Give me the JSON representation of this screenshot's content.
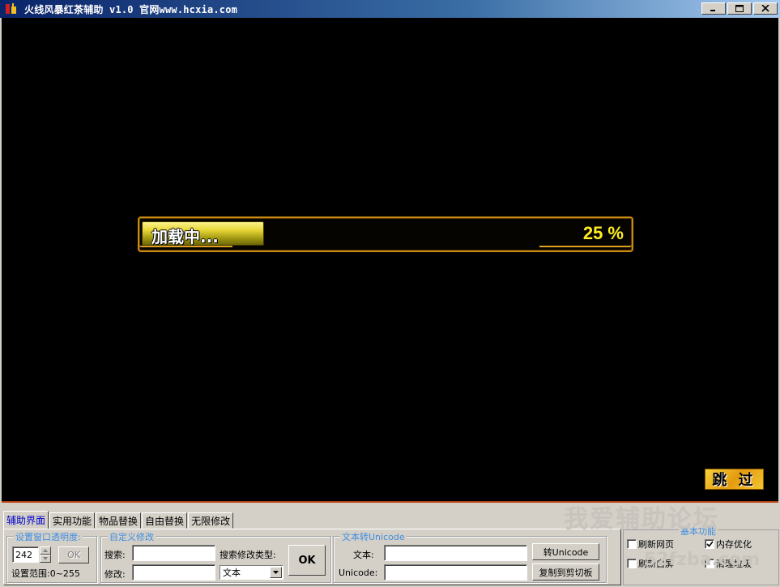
{
  "window": {
    "title": "火线风暴红茶辅助 v1.0 官网www.hcxia.com"
  },
  "game": {
    "loading_label": "加载中...",
    "loading_percent_text": "25 %",
    "loading_progress": 0.25,
    "skip_label": "跳 过"
  },
  "tabs": [
    {
      "label": "辅助界面",
      "active": true
    },
    {
      "label": "实用功能"
    },
    {
      "label": "物品替换"
    },
    {
      "label": "自由替换"
    },
    {
      "label": "无限修改"
    }
  ],
  "opacity": {
    "title": "设置窗口透明度:",
    "value": "242",
    "ok_label": "OK",
    "range_label": "设置范围:0~255"
  },
  "custom": {
    "title": "自定义修改",
    "search_label": "搜索:",
    "modify_label": "修改:",
    "search_value": "",
    "modify_value": "",
    "type_label": "搜索修改类型:",
    "type_selected": "文本",
    "ok_label": "OK"
  },
  "unicode": {
    "title": "文本转Unicode",
    "text_label": "文本:",
    "unicode_label": "Unicode:",
    "text_value": "",
    "unicode_value": "",
    "convert_label": "转Unicode",
    "copy_label": "复制到剪切板"
  },
  "basic": {
    "title": "基本功能",
    "items": [
      {
        "label": "刷新网页",
        "checked": false
      },
      {
        "label": "内存优化",
        "checked": true
      },
      {
        "label": "刷新白屏",
        "checked": false
      },
      {
        "label": "清理垃圾",
        "checked": false
      }
    ]
  },
  "watermark": {
    "big": "我爱辅助论坛",
    "small": "52fzba.com"
  }
}
